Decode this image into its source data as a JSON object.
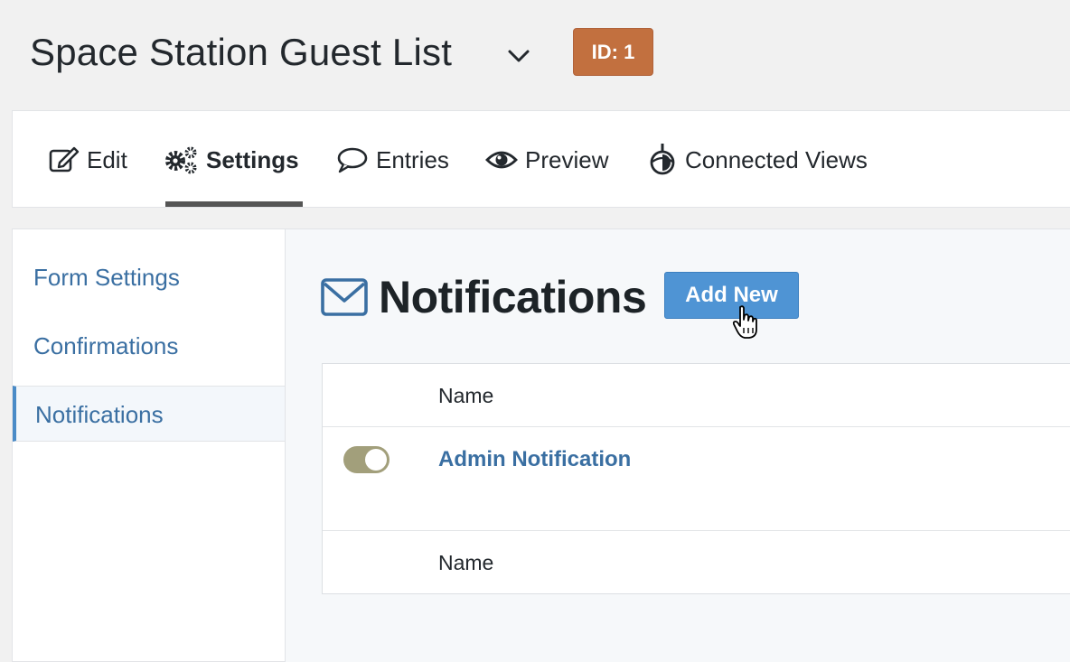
{
  "header": {
    "form_title": "Space Station Guest List",
    "id_badge": "ID: 1"
  },
  "tabs": [
    {
      "label": "Edit",
      "icon": "edit-icon",
      "active": false
    },
    {
      "label": "Settings",
      "icon": "gears-icon",
      "active": true
    },
    {
      "label": "Entries",
      "icon": "comment-icon",
      "active": false
    },
    {
      "label": "Preview",
      "icon": "eye-icon",
      "active": false
    },
    {
      "label": "Connected Views",
      "icon": "gravityview-icon",
      "active": false
    }
  ],
  "sidebar": {
    "items": [
      {
        "label": "Form Settings",
        "active": false
      },
      {
        "label": "Confirmations",
        "active": false
      },
      {
        "label": "Notifications",
        "active": true
      }
    ]
  },
  "main": {
    "page_title": "Notifications",
    "page_icon": "envelope-icon",
    "add_new_label": "Add New",
    "table": {
      "header_name": "Name",
      "footer_name": "Name",
      "rows": [
        {
          "name": "Admin Notification",
          "active": true
        }
      ]
    }
  },
  "colors": {
    "badge": "#c2703f",
    "link": "#3a6fa2",
    "button": "#4f94d4",
    "toggle_on": "#a29f7b"
  }
}
